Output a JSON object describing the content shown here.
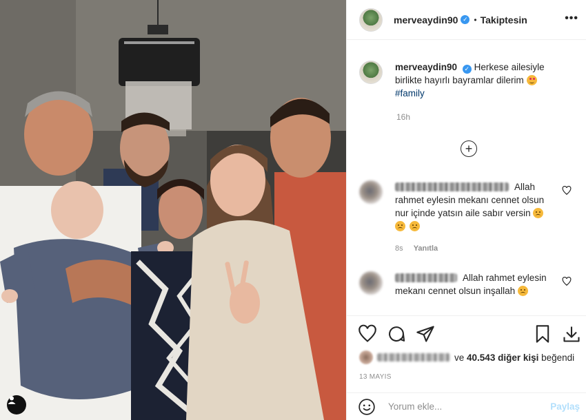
{
  "post": {
    "username": "merveaydin90",
    "follow_status": "Takiptesin",
    "more_icon": "more-horizontal-icon",
    "caption_text": "Herkese ailesiyle birlikte hayırlı bayramlar dilerim",
    "caption_hashtag": "#family",
    "caption_time": "16h",
    "photo_description_icons": [
      "user-tag-icon"
    ]
  },
  "comments": [
    {
      "text": "Allah rahmet eylesin mekanı cennet olsun nur içinde yatsın aile sabır versin",
      "time": "8s",
      "reply_label": "Yanıtla",
      "emoji_count": 3
    },
    {
      "text": "Allah rahmet eylesin mekanı cennet olsun inşallah",
      "emoji_count": 1
    }
  ],
  "actions": {
    "icons": [
      "heart-icon",
      "comment-icon",
      "share-icon",
      "bookmark-icon",
      "download-icon"
    ]
  },
  "likes": {
    "connector": "ve",
    "count_text": "40.543 diğer kişi",
    "suffix": "beğendi"
  },
  "date": "13 MAYIS",
  "comment_box": {
    "placeholder": "Yorum ekle...",
    "post_label": "Paylaş"
  },
  "colors": {
    "verified": "#3897f0",
    "hashtag": "#00376b",
    "post_disabled": "#b2dffc",
    "muted": "#8e8e8e"
  }
}
